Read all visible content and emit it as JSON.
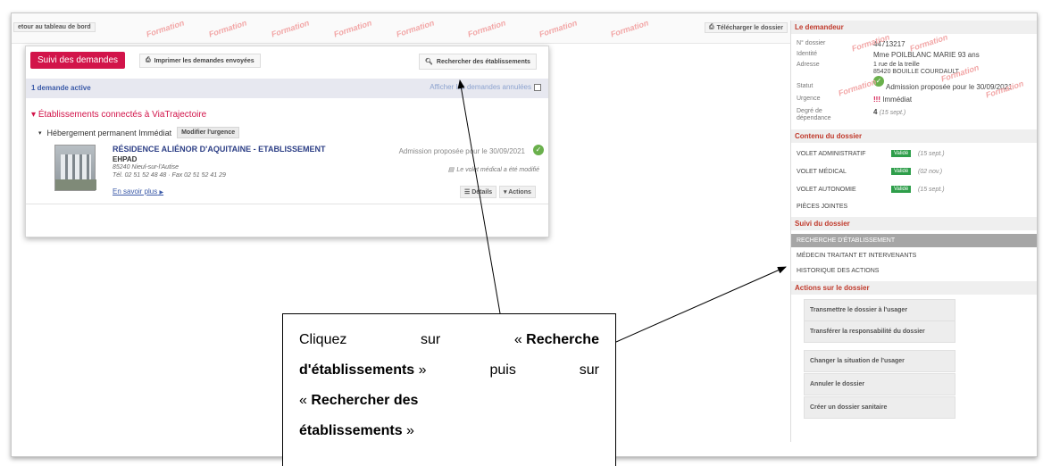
{
  "topbar": {
    "retour": "etour au tableau de bord",
    "telecharger": "Télécharger le dossier"
  },
  "watermark": "Formation",
  "card": {
    "suivi_label": "Suivi des demandes",
    "imprimer_label": "Imprimer les demandes envoyées",
    "rechercher_label": "Rechercher des établissements",
    "active_count": "1 demande active",
    "afficher_annulees": "Afficher les demandes annulées",
    "etab_connectes": "Établissements connectés à ViaTrajectoire",
    "hebergement": "Hébergement permanent Immédiat",
    "modifier_urgence": "Modifier l'urgence",
    "residence_name": "RÉSIDENCE ALIÉNOR D'AQUITAINE - ETABLISSEMENT",
    "residence_type": "EHPAD",
    "residence_address": "85240 Nieul-sur-l'Autise",
    "residence_tel": "Tél. 02 51 52 48 48 · Fax 02 51 52 41 29",
    "en_savoir_plus": "En savoir plus",
    "admission_status": "Admission proposée pour le 30/09/2021",
    "volet_medical_msg": "Le volet médical a été modifié",
    "details_label": "Détails",
    "actions_label": "Actions"
  },
  "side": {
    "demandeur_title": "Le demandeur",
    "fields": [
      {
        "key": "N° dossier",
        "value": "44713217"
      },
      {
        "key": "Identité",
        "value": "Mme POILBLANC MARIE  93 ans"
      },
      {
        "key": "Adresse",
        "value": "1 rue de la treille"
      },
      {
        "key": "",
        "value": "85420 BOUILLE COURDAULT"
      },
      {
        "key": "Statut",
        "value": "Admission proposée pour le 30/09/2021"
      },
      {
        "key": "Urgence",
        "value": "Immédiat"
      },
      {
        "key": "Degré de",
        "value": "4"
      },
      {
        "key": "dépendance",
        "value": ""
      }
    ],
    "degre_date": "(15 sept.)",
    "contenu_title": "Contenu du dossier",
    "volets": [
      {
        "label": "VOLET ADMINISTRATIF",
        "status": "Validé",
        "date": "(15 sept.)"
      },
      {
        "label": "VOLET MÉDICAL",
        "status": "Validé",
        "date": "(02 nov.)"
      },
      {
        "label": "VOLET AUTONOMIE",
        "status": "Validé",
        "date": "(15 sept.)"
      }
    ],
    "pieces_jointes": "PIÈCES JOINTES",
    "suivi_title": "Suivi du dossier",
    "suivi_items": [
      "RECHERCHE D'ÉTABLISSEMENT",
      "MÉDECIN TRAITANT ET INTERVENANTS",
      "HISTORIQUE DES ACTIONS"
    ],
    "actions_title": "Actions sur le dossier",
    "actions": [
      "Transmettre le dossier à l'usager",
      "Transférer la responsabilité du dossier",
      "Changer la situation de l'usager",
      "Annuler le dossier",
      "Créer un dossier sanitaire"
    ]
  },
  "callout": {
    "l1a": "Cliquez",
    "l1b": "sur",
    "l1c": "« ",
    "l1d": "Recherche",
    "l2a": "d'établissements",
    "l2b": " »",
    "l2c": "puis",
    "l2d": "sur",
    "l3a": "« ",
    "l3b": "Rechercher des",
    "l4a": "établissements",
    "l4b": " »"
  }
}
